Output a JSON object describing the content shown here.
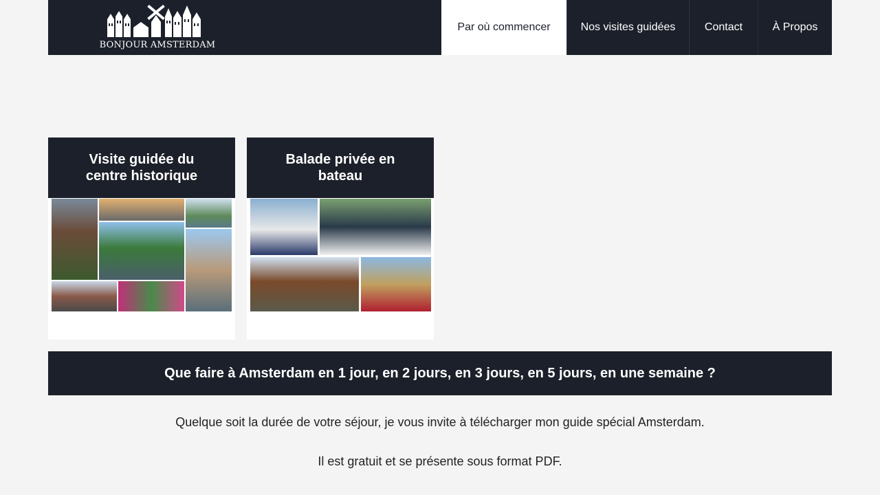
{
  "header": {
    "logo_text": "BONJOUR AMSTERDAM",
    "nav": [
      {
        "label": "Par où commencer",
        "active": true
      },
      {
        "label": "Nos visites guidées",
        "active": false
      },
      {
        "label": "Contact",
        "active": false
      },
      {
        "label": "À Propos",
        "active": false
      }
    ]
  },
  "cards": [
    {
      "title": "Visite guidée du centre historique"
    },
    {
      "title": "Balade privée en bateau"
    }
  ],
  "banner": {
    "text": "Que faire à Amsterdam en 1 jour, en 2 jours, en 3 jours, en 5 jours, en une semaine ?"
  },
  "body": {
    "paragraph1": "Quelque soit la durée de votre séjour, je vous invite à télécharger mon guide spécial Amsterdam.",
    "paragraph2": "Il est gratuit et se présente sous format PDF."
  },
  "colors": {
    "header_bg": "#1b202a",
    "page_bg": "#f4f4f4",
    "active_nav_bg": "#ffffff"
  }
}
